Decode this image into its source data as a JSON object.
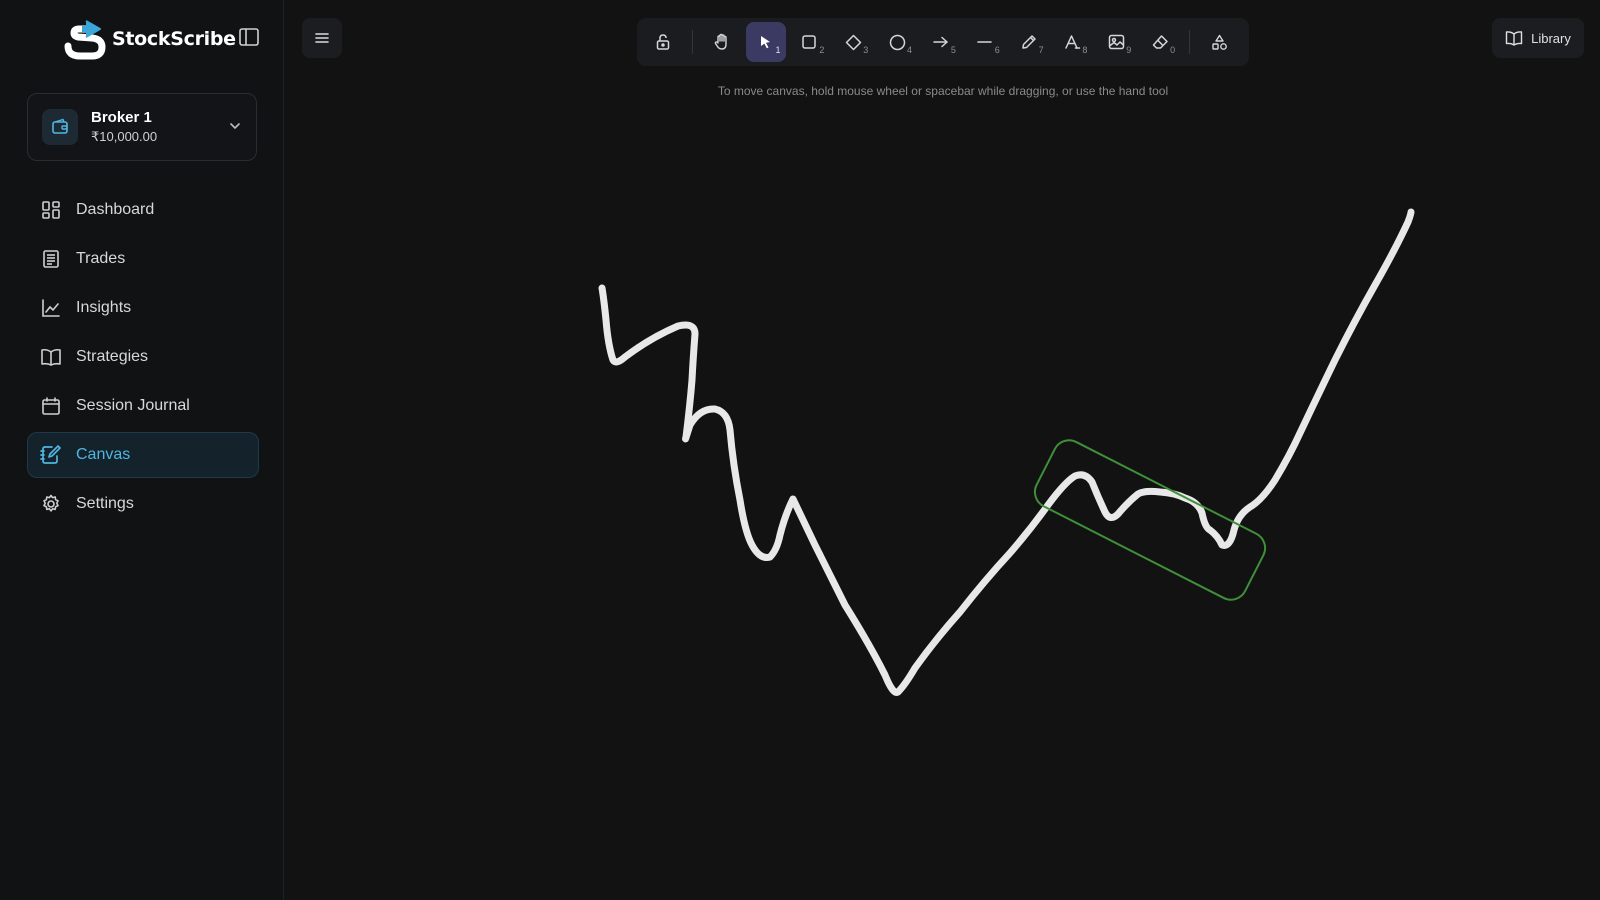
{
  "brand": {
    "name": "StockScribe"
  },
  "broker": {
    "name": "Broker 1",
    "balance": "₹10,000.00"
  },
  "nav": [
    {
      "label": "Dashboard",
      "icon": "dashboard-icon",
      "active": false
    },
    {
      "label": "Trades",
      "icon": "receipt-icon",
      "active": false
    },
    {
      "label": "Insights",
      "icon": "chart-icon",
      "active": false
    },
    {
      "label": "Strategies",
      "icon": "book-icon",
      "active": false
    },
    {
      "label": "Session Journal",
      "icon": "calendar-icon",
      "active": false
    },
    {
      "label": "Canvas",
      "icon": "notebook-pen-icon",
      "active": true
    },
    {
      "label": "Settings",
      "icon": "gear-icon",
      "active": false
    }
  ],
  "toolbar": {
    "tools": [
      {
        "name": "lock",
        "shortcut": ""
      },
      {
        "name": "hand",
        "shortcut": ""
      },
      {
        "name": "selection",
        "shortcut": "1",
        "selected": true
      },
      {
        "name": "rectangle",
        "shortcut": "2"
      },
      {
        "name": "diamond",
        "shortcut": "3"
      },
      {
        "name": "ellipse",
        "shortcut": "4"
      },
      {
        "name": "arrow",
        "shortcut": "5"
      },
      {
        "name": "line",
        "shortcut": "6"
      },
      {
        "name": "draw",
        "shortcut": "7"
      },
      {
        "name": "text",
        "shortcut": "8"
      },
      {
        "name": "image",
        "shortcut": "9"
      },
      {
        "name": "eraser",
        "shortcut": "0"
      },
      {
        "name": "extra-tools",
        "shortcut": ""
      }
    ]
  },
  "hint": "To move canvas, hold mouse wheel or spacebar while dragging, or use the hand tool",
  "library": {
    "label": "Library"
  },
  "colors": {
    "accent": "#4fb6e0",
    "selected_tool": "#3b3a63",
    "stroke": "#e8e8e8",
    "highlight_box": "#3f8f3a"
  }
}
